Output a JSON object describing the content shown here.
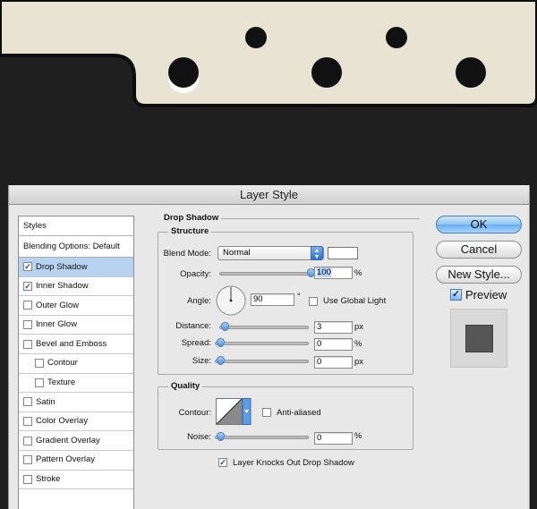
{
  "dialog": {
    "title": "Layer Style"
  },
  "styles_panel": {
    "header": "Styles",
    "blending_options": "Blending Options: Default",
    "items": [
      {
        "label": "Drop Shadow",
        "checked": true,
        "selected": true,
        "indent": false
      },
      {
        "label": "Inner Shadow",
        "checked": true,
        "selected": false,
        "indent": false
      },
      {
        "label": "Outer Glow",
        "checked": false,
        "selected": false,
        "indent": false
      },
      {
        "label": "Inner Glow",
        "checked": false,
        "selected": false,
        "indent": false
      },
      {
        "label": "Bevel and Emboss",
        "checked": false,
        "selected": false,
        "indent": false
      },
      {
        "label": "Contour",
        "checked": false,
        "selected": false,
        "indent": true
      },
      {
        "label": "Texture",
        "checked": false,
        "selected": false,
        "indent": true
      },
      {
        "label": "Satin",
        "checked": false,
        "selected": false,
        "indent": false
      },
      {
        "label": "Color Overlay",
        "checked": false,
        "selected": false,
        "indent": false
      },
      {
        "label": "Gradient Overlay",
        "checked": false,
        "selected": false,
        "indent": false
      },
      {
        "label": "Pattern Overlay",
        "checked": false,
        "selected": false,
        "indent": false
      },
      {
        "label": "Stroke",
        "checked": false,
        "selected": false,
        "indent": false
      }
    ]
  },
  "drop_shadow": {
    "section_title": "Drop Shadow",
    "structure": {
      "title": "Structure",
      "blend_mode_label": "Blend Mode:",
      "blend_mode_value": "Normal",
      "shadow_color": "#ffffff",
      "opacity_label": "Opacity:",
      "opacity_value": "100",
      "opacity_fraction": 1.0,
      "percent_unit": "%",
      "angle_label": "Angle:",
      "angle_value": "90",
      "degree_unit": "°",
      "use_global_light_label": "Use Global Light",
      "use_global_light_checked": false,
      "distance_label": "Distance:",
      "distance_value": "3",
      "distance_fraction": 0.0,
      "px_unit": "px",
      "spread_label": "Spread:",
      "spread_value": "0",
      "spread_fraction": 0.0,
      "size_label": "Size:",
      "size_value": "0",
      "size_fraction": 0.0
    },
    "quality": {
      "title": "Quality",
      "contour_label": "Contour:",
      "anti_aliased_label": "Anti-aliased",
      "anti_aliased_checked": false,
      "noise_label": "Noise:",
      "noise_value": "0",
      "noise_fraction": 0.0,
      "percent_unit": "%"
    },
    "layer_knocks_out_label": "Layer Knocks Out Drop Shadow",
    "layer_knocks_out_checked": true
  },
  "buttons": {
    "ok": "OK",
    "cancel": "Cancel",
    "new_style": "New Style...",
    "preview_label": "Preview",
    "preview_checked": true
  },
  "colors": {
    "canvas_background": "#1f1f1f",
    "ticket_fill": "#e9e3d3",
    "hole_fill": "#111111",
    "selection_blue": "#b7d3ef",
    "accent_blue": "#5a9ee8"
  },
  "icons": {
    "angle": "angle-dial-icon",
    "contour": "contour-curve-icon",
    "dropdown": "updown-arrows-icon",
    "check": "checkmark-icon"
  }
}
